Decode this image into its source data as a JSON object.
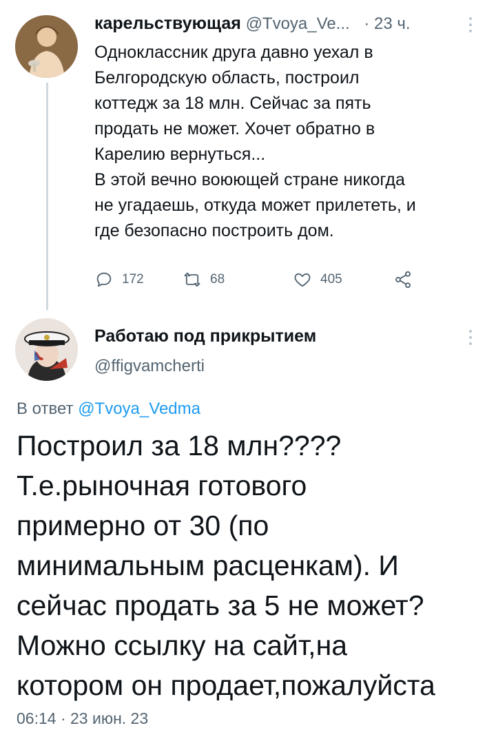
{
  "tweet1": {
    "display_name": "карельствующая",
    "handle": "@Tvoya_Ve...",
    "separator": "·",
    "time": "23 ч.",
    "text_lines": [
      "Одноклассник друга давно уехал в",
      "Белгородскую область, построил",
      "коттедж за 18 млн. Сейчас за пять",
      "продать не может. Хочет обратно в",
      "Карелию вернуться...",
      "В этой вечно воюющей стране никогда",
      "не угадаешь, откуда может прилететь, и",
      "где безопасно построить дом."
    ],
    "replies": "172",
    "retweets": "68",
    "likes": "405"
  },
  "tweet2": {
    "display_name": "Работаю под прикрытием",
    "handle": "@ffigvamcherti",
    "reply_prefix": "В ответ",
    "reply_to": "@Tvoya_Vedma",
    "text_lines": [
      "Построил за 18 млн????",
      "Т.е.рыночная готового",
      "примерно от 30 (по",
      "минимальным расценкам). И",
      "сейчас продать за 5 не может?",
      "Можно ссылку на сайт,на",
      "котором он продает,пожалуйста"
    ],
    "timestamp": "06:14 · 23 июн. 23"
  },
  "icons": {
    "reply": "reply-icon",
    "retweet": "retweet-icon",
    "like": "like-icon",
    "share": "share-icon",
    "more": "more-vertical-icon"
  },
  "colors": {
    "link": "#1d9bf0",
    "muted": "#536471",
    "text": "#0f1419",
    "thread_line": "#cfd9de"
  }
}
